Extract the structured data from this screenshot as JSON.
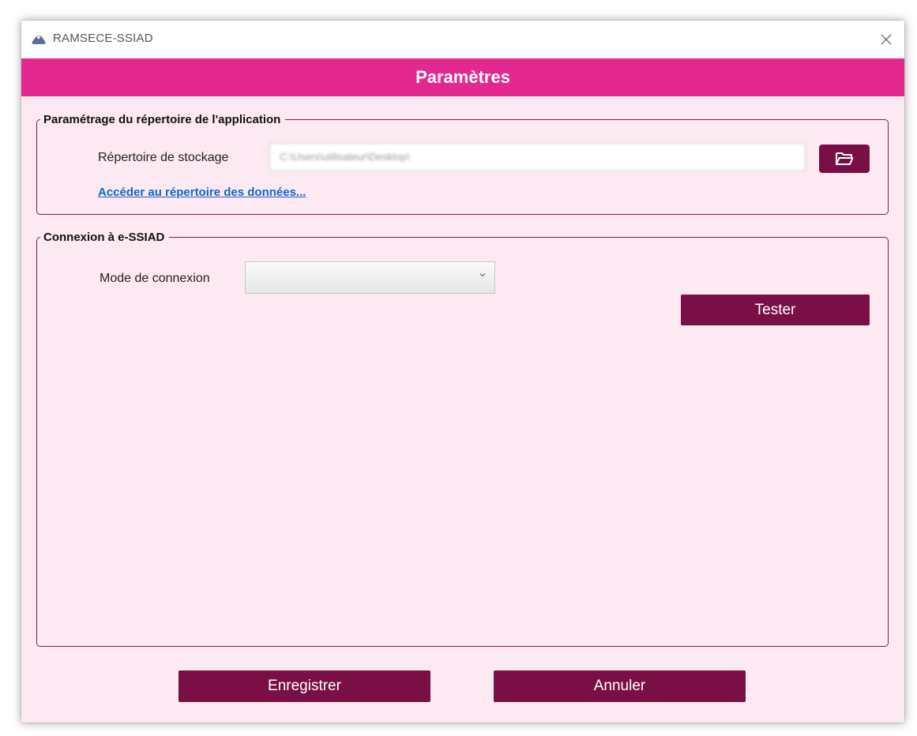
{
  "window": {
    "title": "RAMSECE-SSIAD",
    "icon": "ramsece-logo-icon",
    "close_icon": "close-icon"
  },
  "header": {
    "title": "Paramètres",
    "background_color": "#e3298f"
  },
  "storage_group": {
    "legend": "Paramétrage du répertoire de l'application",
    "storage_label": "Répertoire de stockage",
    "storage_path_value": "C:\\Users\\utilisateur\\Desktop\\",
    "browse_icon": "folder-open-icon",
    "data_link": "Accéder au répertoire des données..."
  },
  "connection_group": {
    "legend": "Connexion à e-SSIAD",
    "mode_label": "Mode de connexion",
    "mode_value": "",
    "test_button": "Tester"
  },
  "footer": {
    "save_button": "Enregistrer",
    "cancel_button": "Annuler"
  },
  "colors": {
    "accent": "#7a0f45",
    "window_background": "#fde9f2",
    "link": "#1166cc"
  }
}
